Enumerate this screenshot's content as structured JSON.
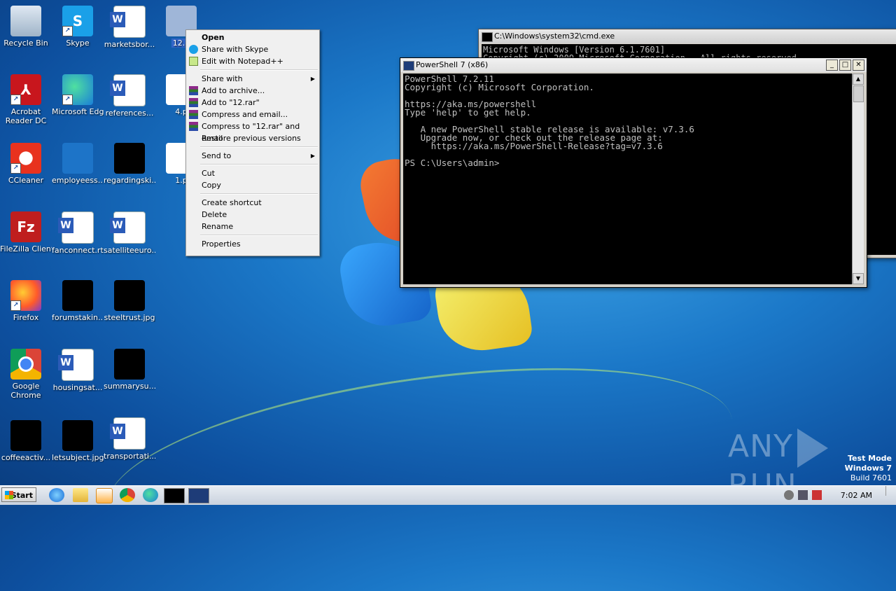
{
  "desktop": {
    "icons": [
      {
        "name": "recycle-bin-icon",
        "label": "Recycle Bin"
      },
      {
        "name": "skype-icon",
        "label": "Skype"
      },
      {
        "name": "word-doc-icon",
        "label": "marketsbor..."
      },
      {
        "name": "file-icon",
        "label": "12.p"
      },
      {
        "name": "acrobat-icon",
        "label": "Acrobat Reader DC"
      },
      {
        "name": "edge-icon",
        "label": "Microsoft Edge"
      },
      {
        "name": "word-doc-icon",
        "label": "references..."
      },
      {
        "name": "file-icon",
        "label": "4.p"
      },
      {
        "name": "ccleaner-icon",
        "label": "CCleaner"
      },
      {
        "name": "image-file-icon",
        "label": "employeess..."
      },
      {
        "name": "image-file-icon",
        "label": "regardingski..."
      },
      {
        "name": "file-icon",
        "label": "1.p"
      },
      {
        "name": "filezilla-icon",
        "label": "FileZilla Client"
      },
      {
        "name": "word-doc-icon",
        "label": "fanconnect.rtf"
      },
      {
        "name": "word-doc-icon",
        "label": "satelliteeuro..."
      },
      {
        "name": "firefox-icon",
        "label": "Firefox"
      },
      {
        "name": "image-file-icon",
        "label": "forumstakin..."
      },
      {
        "name": "image-file-icon",
        "label": "steeltrust.jpg"
      },
      {
        "name": "chrome-icon",
        "label": "Google Chrome"
      },
      {
        "name": "word-doc-icon",
        "label": "housingsat..."
      },
      {
        "name": "image-file-icon",
        "label": "summarysu..."
      },
      {
        "name": "image-file-icon",
        "label": "coffeeactiv..."
      },
      {
        "name": "image-file-icon",
        "label": "letsubject.jpg"
      },
      {
        "name": "word-doc-icon",
        "label": "transportati..."
      }
    ]
  },
  "context_menu": {
    "items": [
      {
        "label": "Open",
        "bold": true
      },
      {
        "label": "Share with Skype"
      },
      {
        "label": "Edit with Notepad++"
      },
      {
        "label": "Share with"
      },
      {
        "label": "Add to archive..."
      },
      {
        "label": "Add to \"12.rar\""
      },
      {
        "label": "Compress and email..."
      },
      {
        "label": "Compress to \"12.rar\" and email"
      },
      {
        "label": "Restore previous versions"
      },
      {
        "label": "Send to"
      },
      {
        "label": "Cut"
      },
      {
        "label": "Copy"
      },
      {
        "label": "Create shortcut"
      },
      {
        "label": "Delete"
      },
      {
        "label": "Rename"
      },
      {
        "label": "Properties"
      }
    ]
  },
  "cmd_window": {
    "title": "C:\\Windows\\system32\\cmd.exe",
    "lines": [
      "Microsoft Windows [Version 6.1.7601]",
      "Copyright (c) 2009 Microsoft Corporation.  All rights reserved."
    ]
  },
  "ps_window": {
    "title": "PowerShell 7 (x86)",
    "lines": [
      "PowerShell 7.2.11",
      "Copyright (c) Microsoft Corporation.",
      "",
      "https://aka.ms/powershell",
      "Type 'help' to get help.",
      "",
      "   A new PowerShell stable release is available: v7.3.6",
      "   Upgrade now, or check out the release page at:",
      "     https://aka.ms/PowerShell-Release?tag=v7.3.6",
      "",
      "PS C:\\Users\\admin>"
    ]
  },
  "window_buttons": {
    "minimize": "_",
    "maximize": "□",
    "close": "✕"
  },
  "watermark": {
    "left": "ANY",
    "right": "RUN"
  },
  "test_mode": {
    "line1": "Test Mode",
    "line2": "Windows 7",
    "line3": "Build 7601"
  },
  "taskbar": {
    "start_label": "Start",
    "clock": "7:02 AM"
  }
}
